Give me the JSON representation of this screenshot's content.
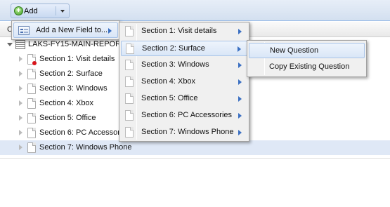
{
  "toolbar": {
    "add_label": "Add",
    "add_icon": "plus-circle-icon"
  },
  "grid": {
    "header_partial": "C",
    "root": {
      "label": "LAKS-FY15-MAIN-REPOR",
      "icon": "list-icon"
    },
    "rows": [
      {
        "label": "Section 1: Visit details",
        "alert": true
      },
      {
        "label": "Section 2: Surface"
      },
      {
        "label": "Section 3: Windows"
      },
      {
        "label": "Section 4: Xbox"
      },
      {
        "label": "Section 5: Office"
      },
      {
        "label": "Section 6: PC Accessor"
      },
      {
        "label": "Section 7: Windows Phone",
        "selected": true
      }
    ]
  },
  "menu1": {
    "items": [
      {
        "label": "Add a New Field to...",
        "icon": "form-field-icon",
        "has_submenu": true
      }
    ]
  },
  "menu2": {
    "items": [
      {
        "label": "Section 1: Visit details"
      },
      {
        "label": "Section 2: Surface",
        "active": true
      },
      {
        "label": "Section 3: Windows"
      },
      {
        "label": "Section 4: Xbox"
      },
      {
        "label": "Section 5: Office"
      },
      {
        "label": "Section 6: PC Accessories"
      },
      {
        "label": "Section 7: Windows Phone"
      }
    ]
  },
  "menu3": {
    "items": [
      {
        "label": "New Question",
        "active": true
      },
      {
        "label": "Copy Existing Question"
      }
    ]
  },
  "colors": {
    "accent": "#3a6fc2",
    "selection": "#dfe8f6",
    "toolbar": "#d3e0f0",
    "alert": "#d8141a"
  }
}
